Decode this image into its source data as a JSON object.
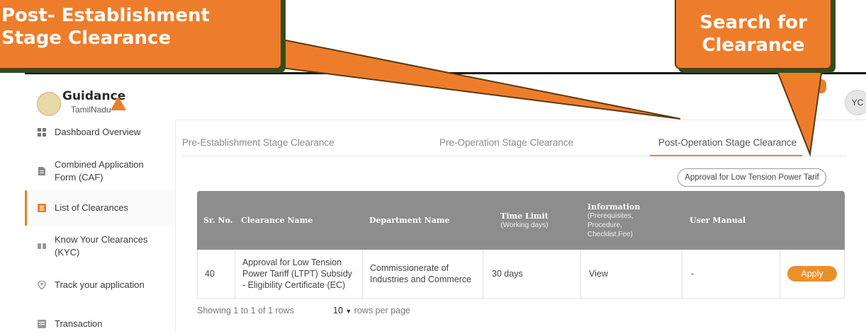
{
  "callouts": {
    "left_line1": "Post- Establishment",
    "left_line2": "Stage Clearance",
    "right_line1": "Search for",
    "right_line2": "Clearance"
  },
  "header": {
    "logo_text": "Guidance",
    "logo_sub": "TamilNadu",
    "avatar": "YC"
  },
  "sidebar": {
    "items": [
      {
        "label": "Dashboard Overview",
        "icon": "dashboard-icon"
      },
      {
        "label": "Combined Application Form (CAF)",
        "icon": "document-icon"
      },
      {
        "label": "List of Clearances",
        "icon": "list-icon"
      },
      {
        "label": "Know Your Clearances (KYC)",
        "icon": "book-icon"
      },
      {
        "label": "Track your application",
        "icon": "location-pin-icon"
      },
      {
        "label": "Transaction",
        "icon": "transaction-icon"
      }
    ]
  },
  "tabs": [
    {
      "label": "Pre-Establishment Stage Clearance"
    },
    {
      "label": "Pre-Operation Stage Clearance"
    },
    {
      "label": "Post-Operation Stage Clearance"
    }
  ],
  "search": {
    "value": "Approval for Low Tension Power Tarif"
  },
  "table": {
    "headers": {
      "sr_no": "Sr. No.",
      "clearance_name": "Clearance Name",
      "department": "Department Name",
      "time_limit": "Time Limit",
      "time_limit_sub": "(Working days)",
      "information": "Information",
      "information_sub": "(Prerequisites, Procedure, Checklist,Fee)",
      "user_manual": "User Manual"
    },
    "rows": [
      {
        "sr_no": "40",
        "clearance_name": "Approval for Low Tension Power Tariff (LTPT) Subsidy - Eligibility Certificate (EC)",
        "department": "Commissionerate of Industries and Commerce",
        "time_limit": "30 days",
        "information": "View",
        "user_manual": "-",
        "action": "Apply"
      }
    ]
  },
  "footer": {
    "showing": "Showing 1 to 1 of 1 rows",
    "page_size": "10",
    "rows_per_page": "rows per page"
  },
  "colors": {
    "accent": "#e9802a",
    "table_header": "#8d8d8d",
    "callout": "#ee7d2b"
  }
}
